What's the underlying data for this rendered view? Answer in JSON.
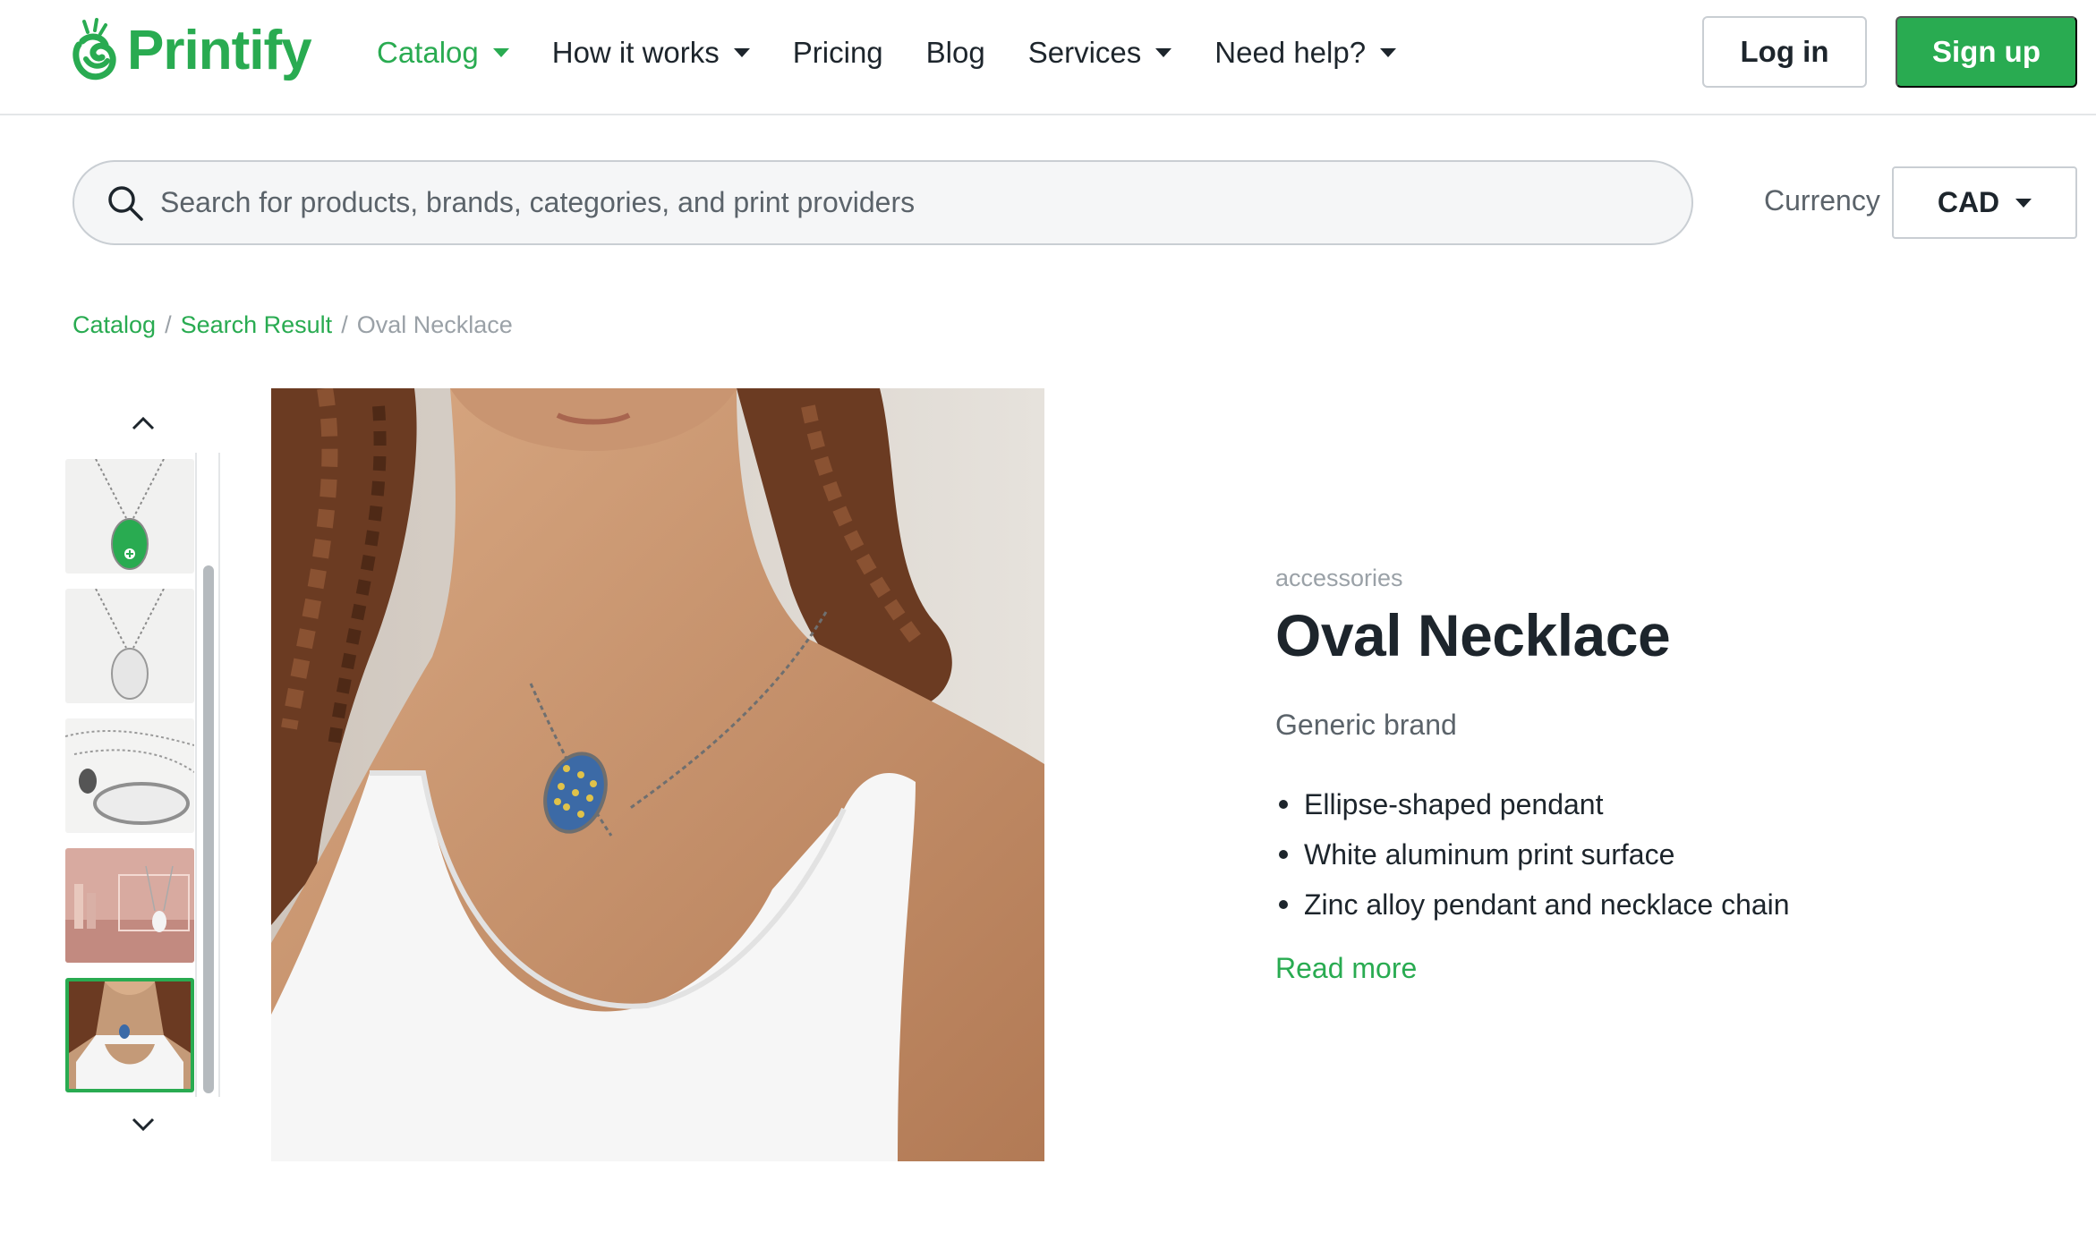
{
  "colors": {
    "brand_green": "#29ab51",
    "text_dark": "#1d252c",
    "text_muted": "#5b636a",
    "text_light": "#9aa1a7",
    "border": "#c9ced3"
  },
  "header": {
    "logo_text": "Printify",
    "nav": [
      {
        "label": "Catalog",
        "has_dropdown": true,
        "active": true
      },
      {
        "label": "How it works",
        "has_dropdown": true,
        "active": false
      },
      {
        "label": "Pricing",
        "has_dropdown": false,
        "active": false
      },
      {
        "label": "Blog",
        "has_dropdown": false,
        "active": false
      },
      {
        "label": "Services",
        "has_dropdown": true,
        "active": false
      },
      {
        "label": "Need help?",
        "has_dropdown": true,
        "active": false
      }
    ],
    "login_label": "Log in",
    "signup_label": "Sign up"
  },
  "search": {
    "placeholder": "Search for products, brands, categories, and print providers",
    "value": "",
    "icon": "search-icon"
  },
  "currency": {
    "label": "Currency",
    "selected": "CAD"
  },
  "breadcrumb": {
    "items": [
      {
        "label": "Catalog",
        "link": true
      },
      {
        "label": "Search Result",
        "link": true
      },
      {
        "label": "Oval Necklace",
        "link": false
      }
    ],
    "separator": "/"
  },
  "gallery": {
    "thumbnails": [
      {
        "alt": "Necklace with green pendant",
        "selected": false
      },
      {
        "alt": "Necklace with white pendant",
        "selected": false
      },
      {
        "alt": "Necklace chain and pendant laid flat",
        "selected": false
      },
      {
        "alt": "Necklace in pink display scene",
        "selected": false
      },
      {
        "alt": "Model wearing necklace",
        "selected": true
      }
    ],
    "up_icon": "chevron-up-icon",
    "down_icon": "chevron-down-icon"
  },
  "product": {
    "category": "accessories",
    "title": "Oval Necklace",
    "brand": "Generic brand",
    "features": [
      "Ellipse-shaped pendant",
      "White aluminum print surface",
      "Zinc alloy pendant and necklace chain"
    ],
    "read_more": "Read more"
  }
}
